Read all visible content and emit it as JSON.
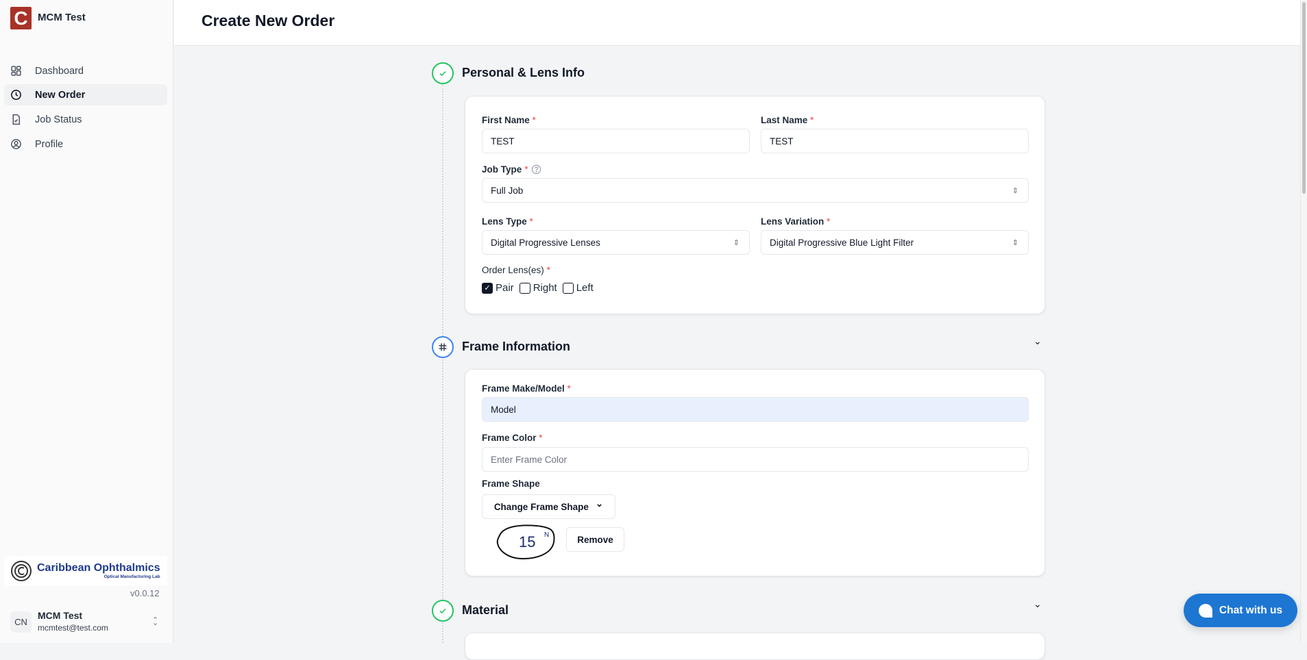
{
  "app": {
    "name": "MCM Test"
  },
  "sidebar": {
    "items": [
      {
        "label": "Dashboard"
      },
      {
        "label": "New Order"
      },
      {
        "label": "Job Status"
      },
      {
        "label": "Profile"
      }
    ],
    "company": {
      "name": "Caribbean Ophthalmics",
      "tagline": "Optical Manufacturing Lab"
    },
    "version": "v0.0.12",
    "user": {
      "initials": "CN",
      "name": "MCM Test",
      "email": "mcmtest@test.com"
    }
  },
  "header": {
    "title": "Create New Order"
  },
  "sections": {
    "personal": {
      "title": "Personal & Lens Info",
      "first_name": {
        "label": "First Name",
        "value": "TEST"
      },
      "last_name": {
        "label": "Last Name",
        "value": "TEST"
      },
      "job_type": {
        "label": "Job Type",
        "value": "Full Job"
      },
      "lens_type": {
        "label": "Lens Type",
        "value": "Digital Progressive Lenses"
      },
      "lens_variation": {
        "label": "Lens Variation",
        "value": "Digital Progressive Blue Light Filter"
      },
      "order_lenses": {
        "label": "Order Lens(es)",
        "options": [
          {
            "label": "Pair",
            "checked": true
          },
          {
            "label": "Right",
            "checked": false
          },
          {
            "label": "Left",
            "checked": false
          }
        ]
      }
    },
    "frame": {
      "title": "Frame Information",
      "make_model": {
        "label": "Frame Make/Model",
        "value": "Model"
      },
      "color": {
        "label": "Frame Color",
        "placeholder": "Enter Frame Color"
      },
      "shape": {
        "label": "Frame Shape",
        "button": "Change Frame Shape",
        "shape_number": "15",
        "shape_mark": "N",
        "remove": "Remove"
      }
    },
    "material": {
      "title": "Material"
    }
  },
  "required_mark": "*",
  "chat": {
    "label": "Chat with us"
  }
}
